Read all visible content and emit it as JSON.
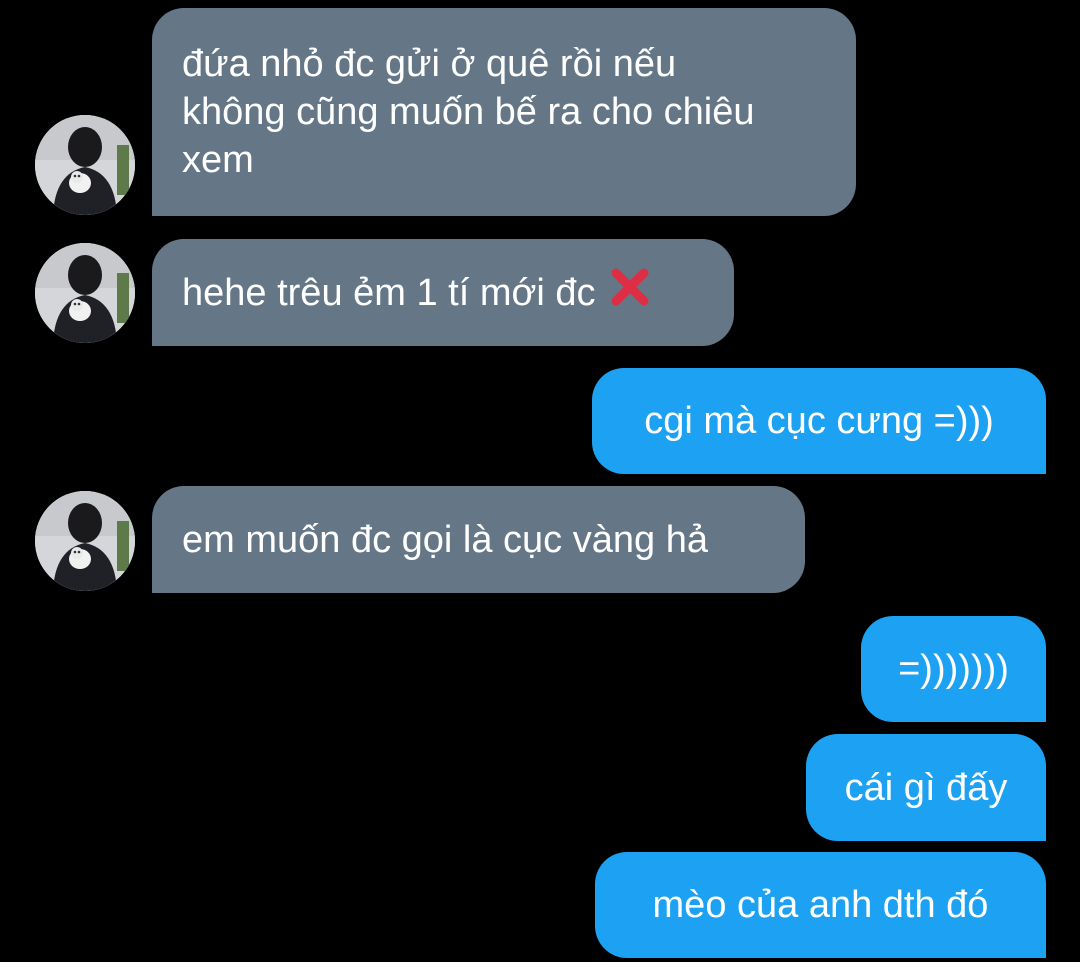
{
  "conversation": {
    "messages": [
      {
        "direction": "incoming",
        "text": "đứa nhỏ đc gửi ở quê rồi nếu\nkhông cũng muốn bế ra cho chiêu\nxem",
        "has_avatar": true
      },
      {
        "direction": "incoming",
        "text": "hehe trêu ẻm 1 tí mới đc",
        "has_avatar": true,
        "trailing_emoji": "cross-mark-icon"
      },
      {
        "direction": "outgoing",
        "text": "cgi mà cục cưng =)))"
      },
      {
        "direction": "incoming",
        "text": "em muốn đc gọi là cục vàng hả",
        "has_avatar": true
      },
      {
        "direction": "outgoing",
        "text": "=)))))))"
      },
      {
        "direction": "outgoing",
        "text": "cái gì đấy"
      },
      {
        "direction": "outgoing",
        "text": "mèo của anh dth đó"
      }
    ]
  },
  "colors": {
    "background": "#000000",
    "incoming_bubble": "#657786",
    "outgoing_bubble": "#1da1f2",
    "text": "#ffffff",
    "cross_mark": "#dd2e44"
  }
}
